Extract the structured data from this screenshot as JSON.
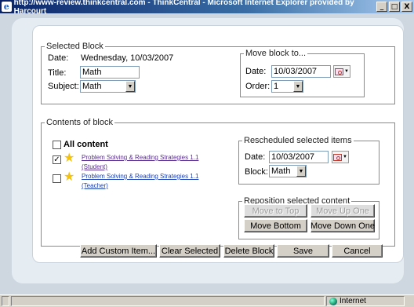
{
  "window": {
    "title": "http://www-review.thinkcentral.com - ThinkCentral - Microsoft Internet Explorer provided by Harcourt",
    "buttons": [
      "_",
      "□",
      "X"
    ]
  },
  "selected_block": {
    "legend": "Selected Block",
    "date_label": "Date:",
    "date_value": "Wednesday, 10/03/2007",
    "title_label": "Title:",
    "title_value": "Math",
    "subject_label": "Subject:",
    "subject_value": "Math"
  },
  "move_block": {
    "legend": "Move block to...",
    "date_label": "Date:",
    "date_value": "10/03/2007",
    "order_label": "Order:",
    "order_value": "1"
  },
  "contents": {
    "legend": "Contents of block",
    "all_label": "All content",
    "items": [
      {
        "checked": "✓",
        "title": "Problem Solving & Reading Strategies 1.1",
        "sub": "(Student)"
      },
      {
        "checked": "",
        "title": "Problem Solving & Reading Strategies 1.1",
        "sub": "(Teacher)"
      }
    ]
  },
  "rescheduled": {
    "legend": "Rescheduled selected items",
    "date_label": "Date:",
    "date_value": "10/03/2007",
    "block_label": "Block:",
    "block_value": "Math"
  },
  "reposition": {
    "legend": "Reposition selected content",
    "move_top": "Move to Top",
    "move_up": "Move Up One",
    "move_bottom": "Move Bottom",
    "move_down": "Move Down One"
  },
  "actions": {
    "add_custom": "Add Custom Item...",
    "clear_selected": "Clear Selected",
    "delete_block": "Delete Block",
    "save": "Save",
    "cancel": "Cancel"
  },
  "status": {
    "zone": "Internet"
  }
}
